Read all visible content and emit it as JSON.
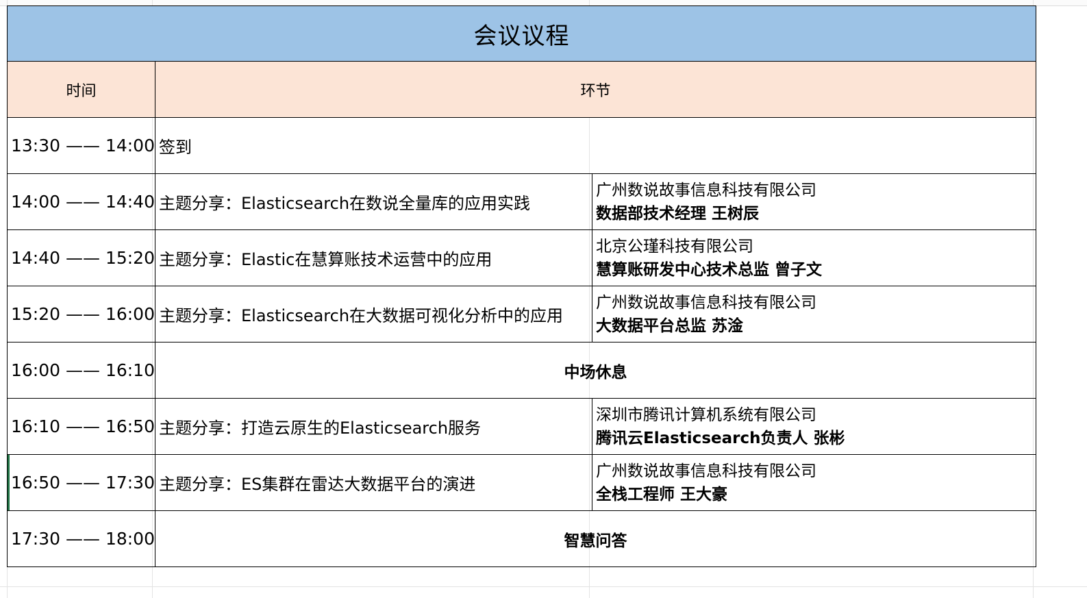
{
  "title": "会议议程",
  "headers": {
    "time": "时间",
    "session": "环节"
  },
  "rows": [
    {
      "time": "13:30 —— 14:00",
      "type": "plain",
      "topic": "签到"
    },
    {
      "time": "14:00 —— 14:40",
      "type": "talk",
      "topic": "主题分享：Elasticsearch在数说全量库的应用实践",
      "company": "广州数说故事信息科技有限公司",
      "speaker": "数据部技术经理 王树辰"
    },
    {
      "time": "14:40 —— 15:20",
      "type": "talk",
      "topic": "主题分享：Elastic在慧算账技术运营中的应用",
      "company": "北京公瑾科技有限公司",
      "speaker": "慧算账研发中心技术总监 曾子文"
    },
    {
      "time": "15:20 —— 16:00",
      "type": "talk",
      "topic": "主题分享：Elasticsearch在大数据可视化分析中的应用",
      "company": "广州数说故事信息科技有限公司",
      "speaker": "大数据平台总监 苏淦"
    },
    {
      "time": "16:00 —— 16:10",
      "type": "break",
      "topic": "中场休息"
    },
    {
      "time": "16:10 —— 16:50",
      "type": "talk",
      "topic": "主题分享：打造云原生的Elasticsearch服务",
      "company": "深圳市腾讯计算机系统有限公司",
      "speaker": "腾讯云Elasticsearch负责人 张彬"
    },
    {
      "time": "16:50 —— 17:30",
      "type": "talk",
      "topic": "主题分享：ES集群在雷达大数据平台的演进",
      "company": "广州数说故事信息科技有限公司",
      "speaker": "全栈工程师 王大豪"
    },
    {
      "time": "17:30 —— 18:00",
      "type": "break",
      "topic": "智慧问答"
    }
  ]
}
